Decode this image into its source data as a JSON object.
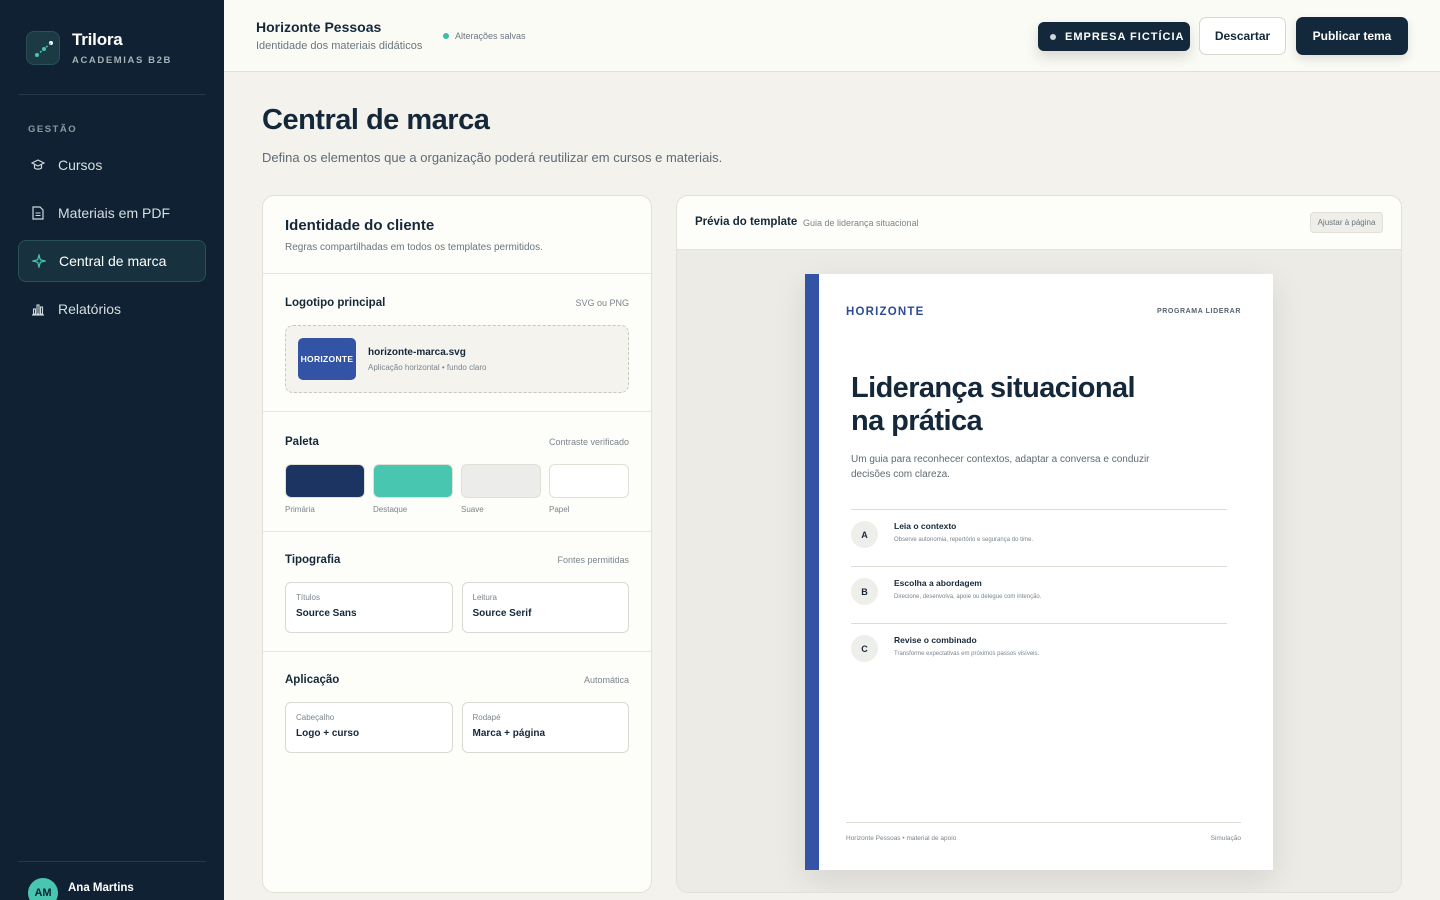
{
  "sidebar": {
    "brand_name": "Trilora",
    "brand_sub": "ACADEMIAS B2B",
    "section_label": "GESTÃO",
    "items": [
      {
        "label": "Cursos",
        "icon": "graduation-cap-icon"
      },
      {
        "label": "Materiais em PDF",
        "icon": "document-icon"
      },
      {
        "label": "Central de marca",
        "icon": "sparkle-icon",
        "active": true
      },
      {
        "label": "Relatórios",
        "icon": "bar-chart-icon"
      }
    ],
    "user": {
      "initials": "AM",
      "name": "Ana Martins"
    }
  },
  "topbar": {
    "title": "Horizonte Pessoas",
    "subtitle": "Identidade dos materiais didáticos",
    "saved_status": "Alterações salvas",
    "tag_label": "EMPRESA FICTÍCIA",
    "discard_label": "Descartar",
    "publish_label": "Publicar tema"
  },
  "page": {
    "title": "Central de marca",
    "subtitle": "Defina os elementos que a organização poderá reutilizar em cursos e materiais."
  },
  "identity": {
    "title": "Identidade do cliente",
    "subtitle": "Regras compartilhadas em todos os templates permitidos.",
    "logo": {
      "title": "Logotipo principal",
      "meta": "SVG ou PNG",
      "thumb_text": "HORIZONTE",
      "file_name": "horizonte-marca.svg",
      "file_desc": "Aplicação horizontal • fundo claro"
    },
    "palette": {
      "title": "Paleta",
      "meta": "Contraste verificado",
      "swatches": [
        {
          "label": "Primária",
          "color": "#1b3461"
        },
        {
          "label": "Destaque",
          "color": "#48c6b0"
        },
        {
          "label": "Suave",
          "color": "#ececea"
        },
        {
          "label": "Papel",
          "color": "#ffffff"
        }
      ]
    },
    "typography": {
      "title": "Tipografia",
      "meta": "Fontes permitidas",
      "fields": [
        {
          "label": "Títulos",
          "value": "Source Sans"
        },
        {
          "label": "Leitura",
          "value": "Source Serif"
        }
      ]
    },
    "application": {
      "title": "Aplicação",
      "meta": "Automática",
      "fields": [
        {
          "label": "Cabeçalho",
          "value": "Logo + curso"
        },
        {
          "label": "Rodapé",
          "value": "Marca + página"
        }
      ]
    }
  },
  "preview": {
    "title": "Prévia do template",
    "subtitle": "Guia de liderança situacional",
    "fit_label": "Ajustar à página",
    "doc": {
      "logo": "HORIZONTE",
      "program": "PROGRAMA LIDERAR",
      "title_line1": "Liderança situacional",
      "title_line2": "na prática",
      "lead": "Um guia para reconhecer contextos, adaptar a conversa e conduzir decisões com clareza.",
      "steps": [
        {
          "badge": "A",
          "title": "Leia o contexto",
          "desc": "Observe autonomia, repertório e segurança do time."
        },
        {
          "badge": "B",
          "title": "Escolha a abordagem",
          "desc": "Direcione, desenvolva, apoie ou delegue com intenção."
        },
        {
          "badge": "C",
          "title": "Revise o combinado",
          "desc": "Transforme expectativas em próximos passos visíveis."
        }
      ],
      "footer_left": "Horizonte Pessoas • material de apoio",
      "footer_right": "Simulação"
    }
  },
  "colors": {
    "sidebar_bg": "#0f2133",
    "accent": "#48c6b0",
    "brand_blue": "#3353a5",
    "ink": "#15283a"
  }
}
